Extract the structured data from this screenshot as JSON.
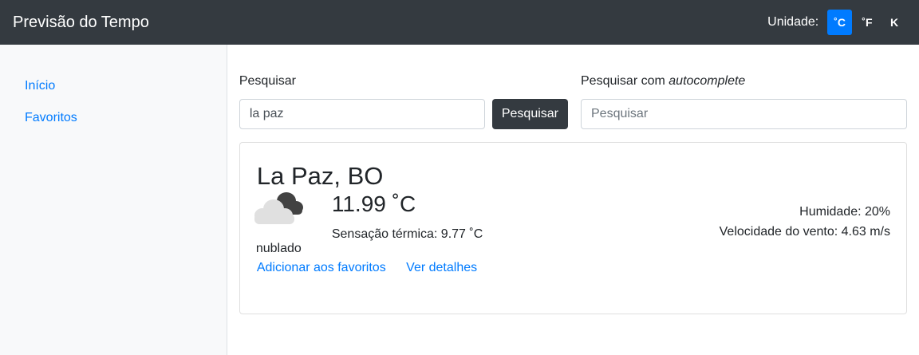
{
  "navbar": {
    "brand": "Previsão do Tempo",
    "unit_label": "Unidade:",
    "units": [
      "˚C",
      "˚F",
      "K"
    ],
    "active_unit": "˚C",
    "bg_color": "#343a40",
    "accent_color": "#007bff"
  },
  "sidebar": {
    "items": [
      {
        "label": "Início"
      },
      {
        "label": "Favoritos"
      }
    ]
  },
  "search": {
    "label": "Pesquisar",
    "value": "la paz",
    "button_label": "Pesquisar",
    "auto_label_prefix": "Pesquisar com ",
    "auto_label_em": "autocomplete",
    "auto_placeholder": "Pesquisar"
  },
  "weather": {
    "city": "La Paz, BO",
    "icon": "cloud-icon",
    "condition": "nublado",
    "temperature": "11.99 ˚C",
    "feels_like": "Sensação térmica: 9.77 ˚C",
    "humidity": "Humidade: 20%",
    "wind": "Velocidade do vento: 4.63 m/s",
    "add_favorite": "Adicionar aos favoritos",
    "details": "Ver detalhes"
  }
}
